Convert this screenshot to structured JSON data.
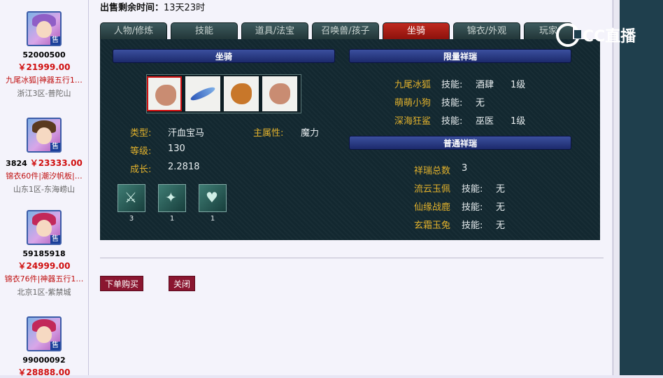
{
  "listings": [
    {
      "id": "52000500",
      "price": "￥21999.00",
      "desc": "九尾冰狐|神器五行1…",
      "server": "浙江3区-普陀山",
      "badge": "售",
      "hair": "#8f5ec6"
    },
    {
      "id": "3824",
      "price": "￥23333.00",
      "desc": "锦衣60件|潮汐帆板|…",
      "server": "山东1区-东海崂山",
      "badge": "售",
      "hair": "#5a3a1f"
    },
    {
      "id": "59185918",
      "price": "￥24999.00",
      "desc": "锦衣76件|神器五行1…",
      "server": "北京1区-紫禁城",
      "badge": "售",
      "hair": "#c2285a"
    },
    {
      "id": "99000092",
      "price": "￥28888.00",
      "desc": "",
      "server": "",
      "badge": "售",
      "hair": "#c2285a"
    }
  ],
  "timer": {
    "label": "出售剩余时间：",
    "value": "13天23时"
  },
  "tabs": [
    "人物/修炼",
    "技能",
    "道具/法宝",
    "召唤兽/孩子",
    "坐骑",
    "锦衣/外观",
    "玩家"
  ],
  "active_tab": "坐骑",
  "left_section": {
    "title": "坐骑",
    "type_label": "类型:",
    "type_value": "汗血宝马",
    "attr_label": "主属性:",
    "attr_value": "魔力",
    "level_label": "等级:",
    "level_value": "130",
    "growth_label": "成长:",
    "growth_value": "2.2818",
    "skill_counts": [
      "3",
      "1",
      "1"
    ]
  },
  "limited_section": {
    "title": "限量祥瑞",
    "items": [
      {
        "name": "九尾冰狐",
        "skill_label": "技能:",
        "skill": "酒肆",
        "level": "1级"
      },
      {
        "name": "萌萌小狗",
        "skill_label": "技能:",
        "skill": "无",
        "level": ""
      },
      {
        "name": "深海狂鲨",
        "skill_label": "技能:",
        "skill": "巫医",
        "level": "1级"
      }
    ]
  },
  "normal_section": {
    "title": "普通祥瑞",
    "total_label": "祥瑞总数",
    "total_value": "3",
    "items": [
      {
        "name": "流云玉佩",
        "skill_label": "技能:",
        "skill": "无"
      },
      {
        "name": "仙缘战鹿",
        "skill_label": "技能:",
        "skill": "无"
      },
      {
        "name": "玄霜玉兔",
        "skill_label": "技能:",
        "skill": "无"
      }
    ]
  },
  "buttons": {
    "buy": "下单购买",
    "close": "关闭"
  },
  "watermark": "CC直播"
}
